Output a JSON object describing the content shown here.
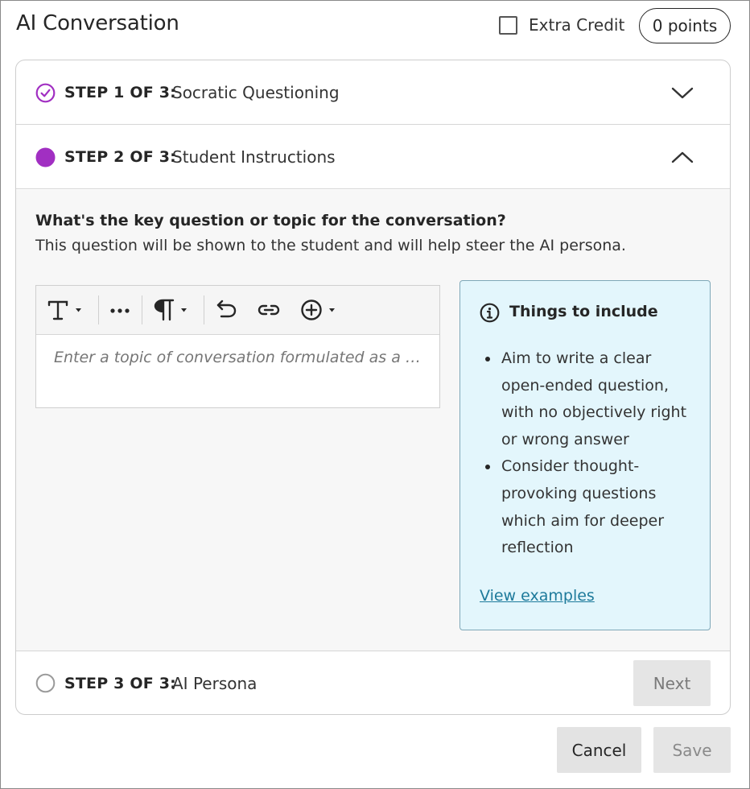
{
  "header": {
    "title": "AI Conversation",
    "extra_credit_label": "Extra Credit",
    "extra_credit_checked": false,
    "points_label": "0 points"
  },
  "steps": [
    {
      "number_label": "STEP 1 OF 3:",
      "name": "Socratic Questioning",
      "status": "completed",
      "expanded": false
    },
    {
      "number_label": "STEP 2 OF 3:",
      "name": "Student Instructions",
      "status": "current",
      "expanded": true
    },
    {
      "number_label": "STEP 3 OF 3:",
      "name": "AI Persona",
      "status": "not-started",
      "expanded": false
    }
  ],
  "step2": {
    "question_title": "What's the key question or topic for the conversation?",
    "question_description": "This question will be shown to the student and will help steer the AI persona.",
    "editor": {
      "placeholder": "Enter a topic of conversation formulated as a question",
      "toolbar": [
        "text-format-icon",
        "more-options-icon",
        "paragraph-icon",
        "undo-icon",
        "link-icon",
        "insert-content-icon"
      ]
    },
    "hint": {
      "title": "Things to include",
      "items": [
        "Aim to write a clear open-ended question, with no objectively right or wrong answer",
        "Consider thought-provoking questions which aim for deeper reflection"
      ],
      "link_label": "View examples"
    }
  },
  "buttons": {
    "next_label": "Next",
    "cancel_label": "Cancel",
    "save_label": "Save"
  },
  "colors": {
    "accent_purple": "#a12fc2",
    "hint_background": "#e3f6fc",
    "link_color": "#1d7a9b"
  }
}
